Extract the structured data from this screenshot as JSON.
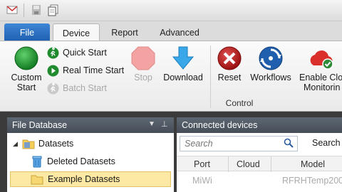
{
  "quick_access": {
    "icons": [
      "new-workspace-icon",
      "save-icon",
      "copy-icon"
    ]
  },
  "tabs": [
    {
      "label": "File"
    },
    {
      "label": "Device"
    },
    {
      "label": "Report"
    },
    {
      "label": "Advanced"
    }
  ],
  "ribbon": {
    "custom_start": {
      "line1": "Custom",
      "line2": "Start",
      "icon": "green-circle-icon"
    },
    "quick_start": {
      "label": "Quick Start",
      "icon": "running-man-icon"
    },
    "real_time_start": {
      "label": "Real Time Start",
      "icon": "play-icon"
    },
    "batch_start": {
      "label": "Batch Start",
      "icon": "running-man-icon"
    },
    "stop": {
      "label": "Stop",
      "icon": "stop-octagon-icon"
    },
    "download": {
      "label": "Download",
      "icon": "download-arrow-icon"
    },
    "reset": {
      "label": "Reset",
      "icon": "reset-x-icon"
    },
    "workflows": {
      "label": "Workflows",
      "icon": "workflows-icon"
    },
    "enable_cloud": {
      "line1": "Enable Clo",
      "line2": "Monitorin",
      "icon": "cloud-check-icon"
    },
    "group_label": "Control"
  },
  "colors": {
    "file_tab": "#2f74c8",
    "panel_header": "#525b66",
    "selected_row": "#fde9a3"
  },
  "file_database": {
    "title": "File Database",
    "items": [
      {
        "label": "Datasets",
        "icon": "folder-icon"
      },
      {
        "label": "Deleted Datasets",
        "icon": "recycle-bin-icon"
      },
      {
        "label": "Example Datasets",
        "icon": "folder-icon"
      }
    ]
  },
  "connected_devices": {
    "title": "Connected devices",
    "search_placeholder": "Search",
    "search_button": "Search",
    "columns": [
      "Port",
      "Cloud",
      "Model"
    ],
    "rows": [
      {
        "port": "MiWi",
        "cloud": "",
        "model": "RFRHTemp200"
      }
    ]
  }
}
